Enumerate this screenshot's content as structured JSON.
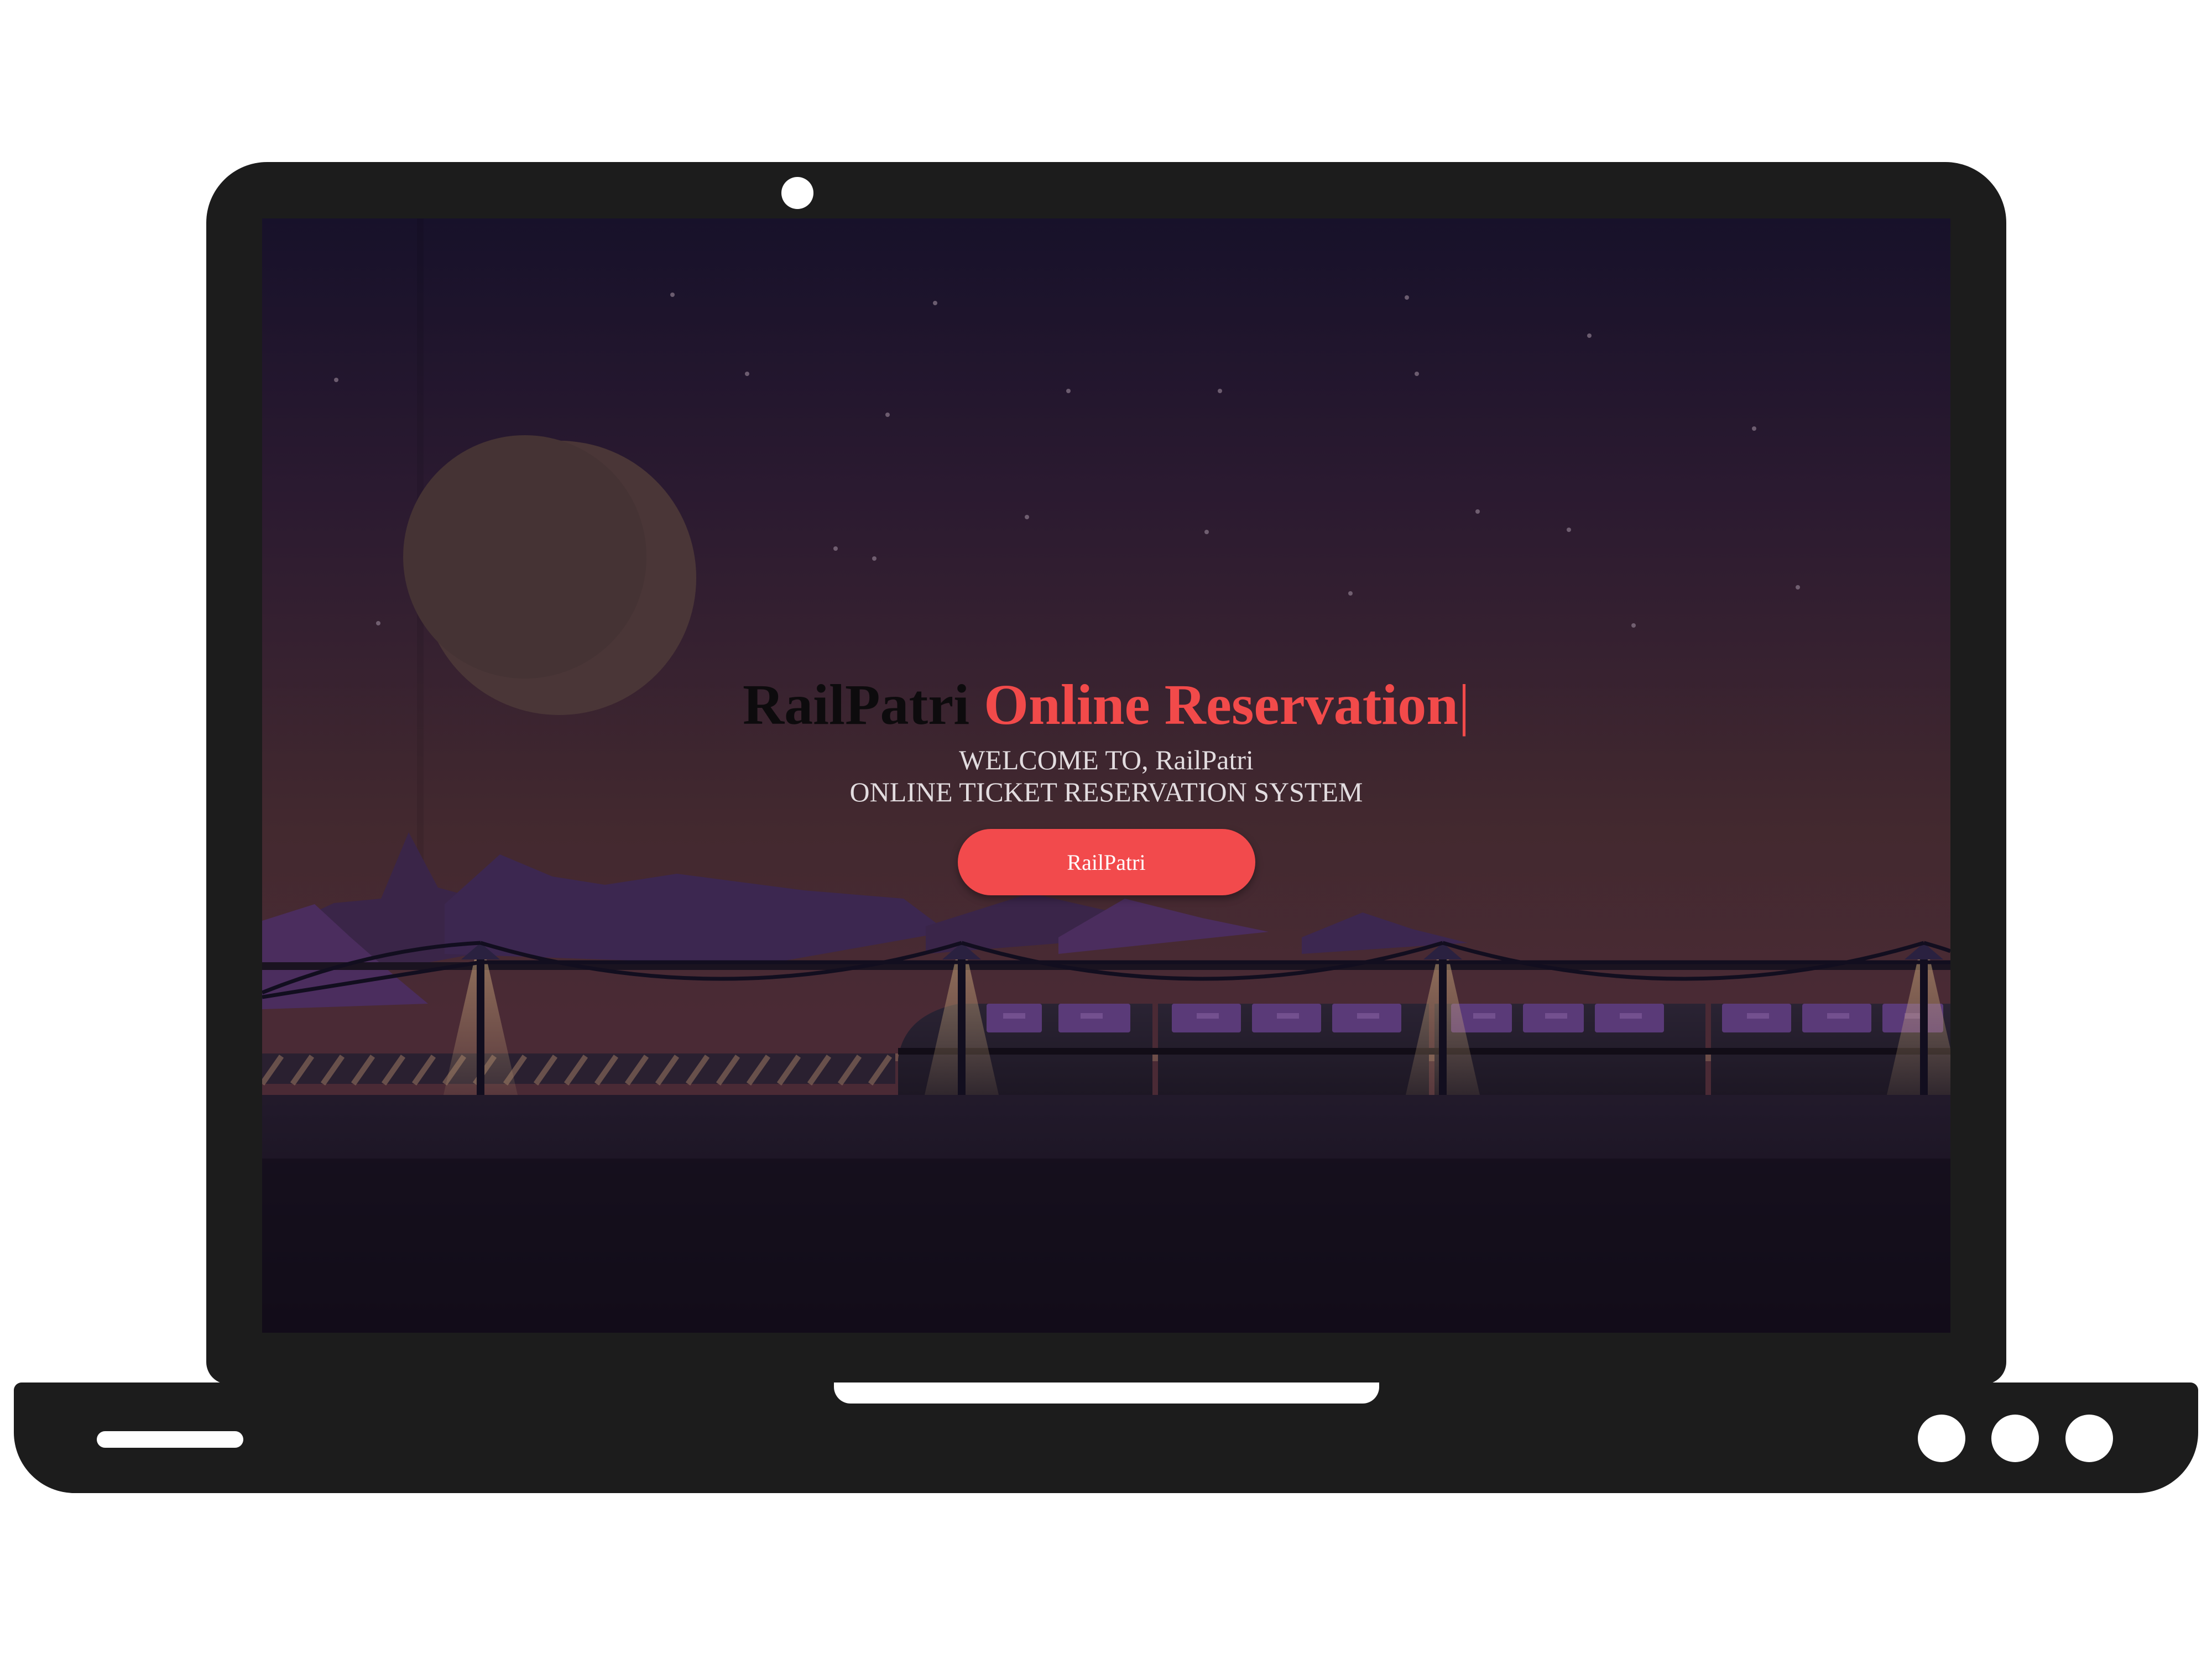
{
  "hero": {
    "brand": "RailPatri",
    "accent": "Online Reservation",
    "cursor": "|",
    "welcome_line": "WELCOME TO, RailPatri",
    "system_line": "ONLINE TICKET RESERVATION SYSTEM",
    "button_label": "RailPatri"
  },
  "colors": {
    "accent": "#f24a4a",
    "button": "#f24a4c",
    "laptop_frame": "#1c1c1c",
    "sky_top": "#17112a",
    "sky_bottom": "#4a2a35"
  },
  "icons": {
    "camera": "webcam-dot",
    "slot": "drive-slot",
    "leds": "indicator-lights"
  }
}
